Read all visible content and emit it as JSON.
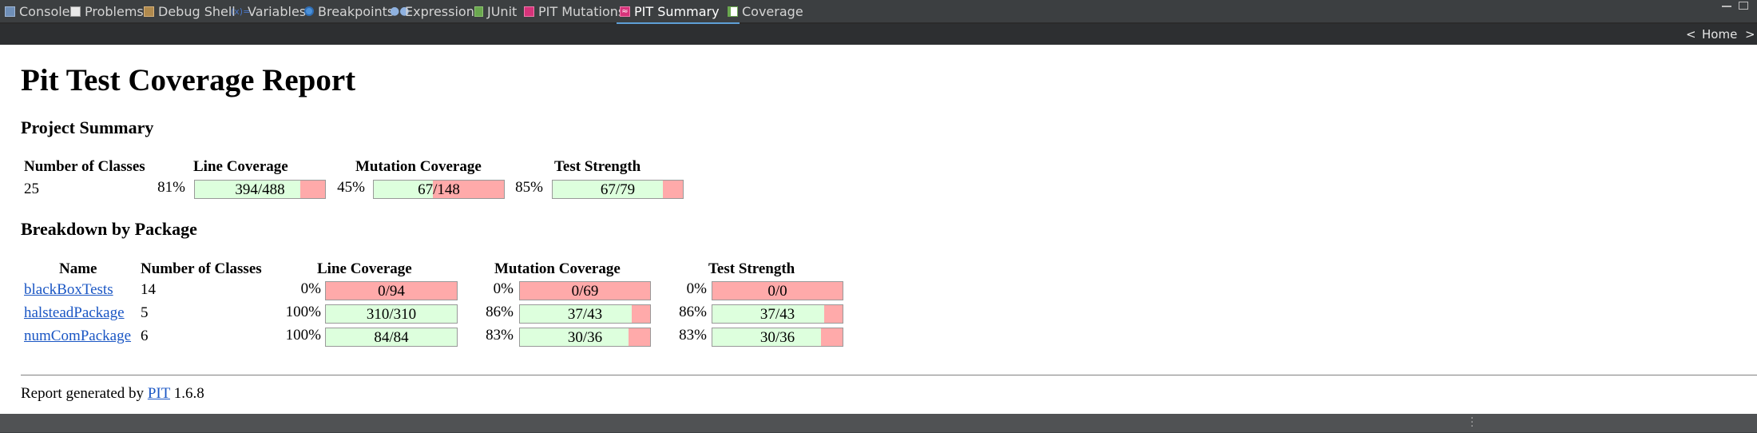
{
  "tabs": [
    {
      "label": "Console",
      "icon": "console-icon",
      "color": "#6f8fb8"
    },
    {
      "label": "Problems",
      "icon": "problems-icon",
      "color": "#c0c0c0"
    },
    {
      "label": "Debug Shell",
      "icon": "debug-shell-icon",
      "color": "#b08a4e"
    },
    {
      "label": "Variables",
      "icon": "variables-icon",
      "color": "#4a77c8"
    },
    {
      "label": "Breakpoints",
      "icon": "breakpoints-icon",
      "color": "#4a90d9"
    },
    {
      "label": "Expressions",
      "icon": "expressions-icon",
      "color": "#8fb2e0"
    },
    {
      "label": "JUnit",
      "icon": "junit-icon",
      "color": "#6aa84f"
    },
    {
      "label": "PIT Mutations",
      "icon": "pit-mutations-icon",
      "color": "#d6337a"
    },
    {
      "label": "PIT Summary",
      "icon": "pit-summary-icon",
      "color": "#d6337a",
      "active": true,
      "close": "✕"
    },
    {
      "label": "Coverage",
      "icon": "coverage-icon",
      "color": "#6aa84f"
    }
  ],
  "nav": {
    "back": "<",
    "home": "Home",
    "forward": ">"
  },
  "report": {
    "title": "Pit Test Coverage Report",
    "project_summary_heading": "Project Summary",
    "summary_headers": {
      "classes": "Number of Classes",
      "line": "Line Coverage",
      "mutation": "Mutation Coverage",
      "strength": "Test Strength"
    },
    "summary": {
      "classes": "25",
      "line": {
        "pct": "81%",
        "text": "394/488",
        "ratio": 0.8074
      },
      "mutation": {
        "pct": "45%",
        "text": "67/148",
        "ratio": 0.4527
      },
      "strength": {
        "pct": "85%",
        "text": "67/79",
        "ratio": 0.8481
      }
    },
    "breakdown_heading": "Breakdown by Package",
    "breakdown_headers": {
      "name": "Name",
      "classes": "Number of Classes",
      "line": "Line Coverage",
      "mutation": "Mutation Coverage",
      "strength": "Test Strength"
    },
    "packages": [
      {
        "name": "blackBoxTests",
        "classes": "14",
        "line": {
          "pct": "0%",
          "text": "0/94",
          "ratio": 0
        },
        "mutation": {
          "pct": "0%",
          "text": "0/69",
          "ratio": 0
        },
        "strength": {
          "pct": "0%",
          "text": "0/0",
          "ratio": 0
        }
      },
      {
        "name": "halsteadPackage",
        "classes": "5",
        "line": {
          "pct": "100%",
          "text": "310/310",
          "ratio": 1
        },
        "mutation": {
          "pct": "86%",
          "text": "37/43",
          "ratio": 0.8605
        },
        "strength": {
          "pct": "86%",
          "text": "37/43",
          "ratio": 0.8605
        }
      },
      {
        "name": "numComPackage",
        "classes": "6",
        "line": {
          "pct": "100%",
          "text": "84/84",
          "ratio": 1
        },
        "mutation": {
          "pct": "83%",
          "text": "30/36",
          "ratio": 0.8333
        },
        "strength": {
          "pct": "83%",
          "text": "30/36",
          "ratio": 0.8333
        }
      }
    ],
    "footer": {
      "prefix": "Report generated by",
      "link": "PIT",
      "version": "1.6.8"
    }
  },
  "colors": {
    "covered": "#ddffdd",
    "uncovered": "#ffaaaa",
    "link": "#1a56c4",
    "active_tab_underline": "#5e9fd6"
  }
}
